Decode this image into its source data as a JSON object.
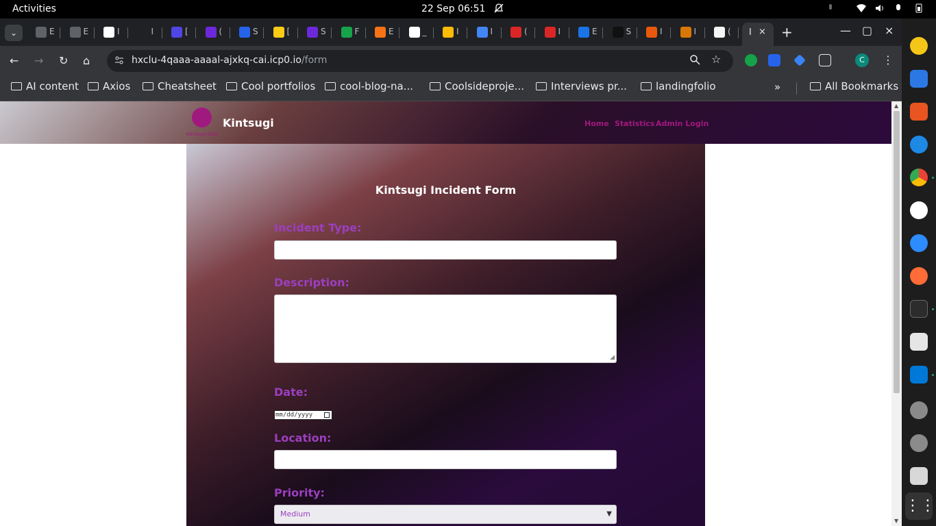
{
  "system_bar": {
    "activities": "Activities",
    "clock": "22 Sep  06:51"
  },
  "tabs": {
    "dropdown_icon": "chevron-down-icon",
    "pinned": [
      {
        "char": "E",
        "color": "#5f6368"
      },
      {
        "char": "E",
        "color": "#5f6368"
      },
      {
        "char": "I",
        "color": "#ffffff"
      },
      {
        "char": "I",
        "color": "#202124"
      },
      {
        "char": "[",
        "color": "#4f46e5"
      },
      {
        "char": "(",
        "color": "#6d28d9"
      },
      {
        "char": "S",
        "color": "#2563eb"
      },
      {
        "char": "[",
        "color": "#facc15"
      },
      {
        "char": "S",
        "color": "#6d28d9"
      },
      {
        "char": "F",
        "color": "#16a34a"
      },
      {
        "char": "E",
        "color": "#f97316"
      },
      {
        "char": "_",
        "color": "#ffffff"
      },
      {
        "char": "I",
        "color": "#fbbc04"
      },
      {
        "char": "I",
        "color": "#4285f4"
      },
      {
        "char": "(",
        "color": "#dc2626"
      },
      {
        "char": "I",
        "color": "#dc2626"
      },
      {
        "char": "E",
        "color": "#1a73e8"
      },
      {
        "char": "S",
        "color": "#111111"
      },
      {
        "char": "I",
        "color": "#ea580c"
      },
      {
        "char": "I",
        "color": "#d97706"
      },
      {
        "char": "(",
        "color": "#f5f5f5"
      }
    ],
    "active": {
      "char": "I",
      "close": "×"
    },
    "new_tab": "+",
    "window_controls": [
      "—",
      "▢",
      "×"
    ]
  },
  "toolbar": {
    "back": "←",
    "forward": "→",
    "reload": "↻",
    "home": "⌂",
    "url_host": "hxclu-4qaaa-aaaal-ajxkq-cai.icp0.io",
    "url_path": "/form",
    "star": "☆",
    "profile_initial": "C",
    "menu": "⋮"
  },
  "bookmarks": {
    "items": [
      "AI content",
      "Axios",
      "Cheatsheet",
      "Cool portfolios",
      "cool-blog-na...",
      "Coolsideproje...",
      "Interviews pr...",
      "landingfolio"
    ],
    "overflow": "»",
    "all": "All Bookmarks"
  },
  "site": {
    "brand": "Kintsugi",
    "logo_caption": "Kintsugi DAO",
    "nav": [
      "Home",
      "Statistics",
      "Admin Login"
    ]
  },
  "form": {
    "title": "Kintsugi Incident Form",
    "incident_type_label": "Incident Type:",
    "description_label": "Description:",
    "date_label": "Date:",
    "date_placeholder": "mm/dd/yyyy",
    "location_label": "Location:",
    "priority_label": "Priority:",
    "priority_value": "Medium"
  },
  "colors": {
    "accent_purple": "#9b3fbf",
    "brand_magenta": "#a0197e"
  },
  "dock": [
    "rhythmbox-icon",
    "text-editor-icon",
    "software-center-icon",
    "help-icon",
    "chrome-icon",
    "slack-icon",
    "zoom-icon",
    "postman-icon",
    "terminal-icon",
    "reader-icon",
    "vscode-icon",
    "disk-icon",
    "disk-icon",
    "trash-icon",
    "app-grid-icon"
  ]
}
